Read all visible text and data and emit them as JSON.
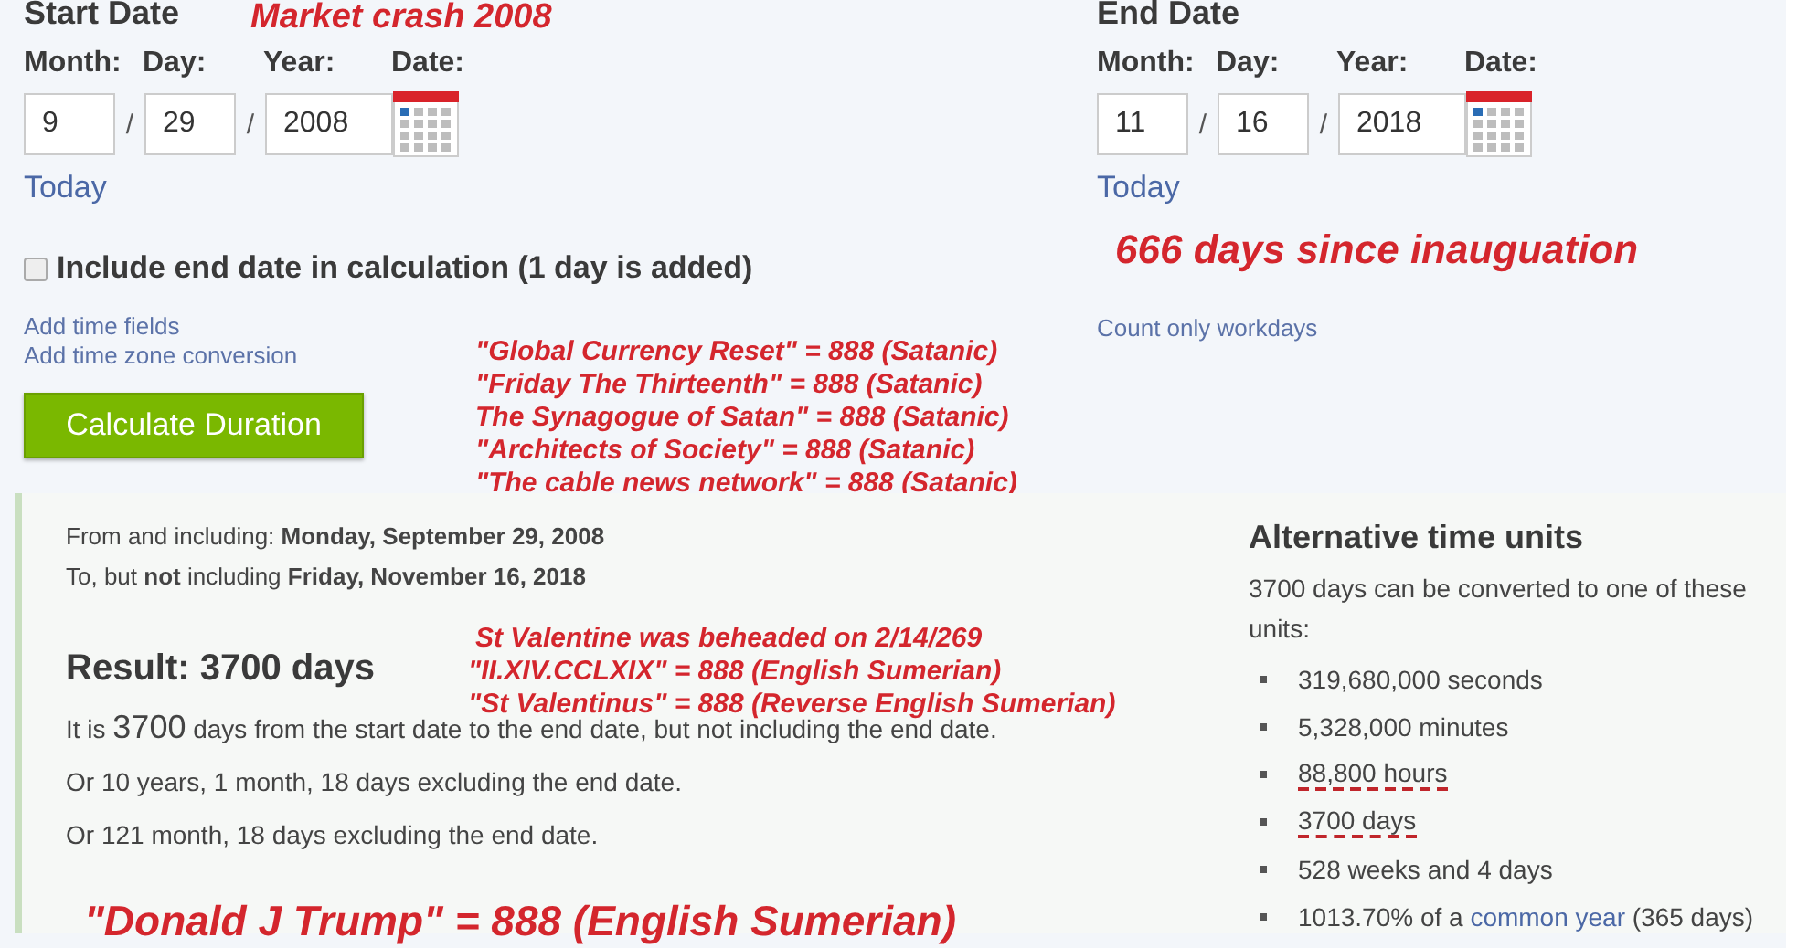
{
  "start": {
    "heading": "Start Date",
    "labels": [
      "Month:",
      "Day:",
      "Year:",
      "Date:"
    ],
    "month": "9",
    "day": "29",
    "year": "2008",
    "separator": "/",
    "today": "Today"
  },
  "end": {
    "heading": "End Date",
    "labels": [
      "Month:",
      "Day:",
      "Year:",
      "Date:"
    ],
    "month": "11",
    "day": "16",
    "year": "2018",
    "separator": "/",
    "today": "Today"
  },
  "include_end": {
    "label": "Include end date in calculation (1 day is added)",
    "checked": false
  },
  "links": [
    "Add time fields",
    "Add time zone conversion"
  ],
  "workdays_link": "Count only workdays",
  "calculate_button": "Calculate Duration",
  "result": {
    "from": "From and including: **Monday, September 29, 2008**",
    "to": "To, but **not** including **Friday, November 16, 2018**",
    "heading": "Result: 3700 days",
    "sentence": {
      "before": "It is",
      "number": "3700",
      "after": "days from the start date to the end date, but not including the end date."
    },
    "lines": [
      "Or 10 years, 1 month, 18 days excluding the end date.",
      "Or 121 month, 18 days excluding the end date."
    ]
  },
  "alternative": {
    "heading": "Alternative time units",
    "intro": "3700 days can be converted to one of these units:",
    "items": [
      {
        "text": "319,680,000 seconds",
        "underlined": false
      },
      {
        "text": "5,328,000 minutes",
        "underlined": false
      },
      {
        "text": "88,800 hours",
        "underlined": true
      },
      {
        "text": "3700 days",
        "underlined": true
      },
      {
        "text": "528 weeks and 4 days",
        "underlined": false
      }
    ],
    "last_item": {
      "before": "1013.70% of a",
      "link": "common year",
      "after": "(365 days)"
    }
  },
  "annotations": {
    "market": "Market crash 2008",
    "inauguration": "666 days since inauguation",
    "satanic": [
      "\"Global Currency Reset\" = 888 (Satanic)",
      "\"Friday The Thirteenth\" = 888 (Satanic)",
      "The Synagogue of Satan\" = 888 (Satanic)",
      "\"Architects of Society\" = 888 (Satanic)",
      "\"The cable news network\" = 888 (Satanic)"
    ],
    "valentine": [
      "St Valentine was beheaded on 2/14/269",
      "\"II.XIV.CCLXIX\" = 888 (English Sumerian)",
      "\"St Valentinus\" = 888 (Reverse English Sumerian)"
    ],
    "trump": "\"Donald J Trump\" = 888 (English Sumerian)"
  }
}
